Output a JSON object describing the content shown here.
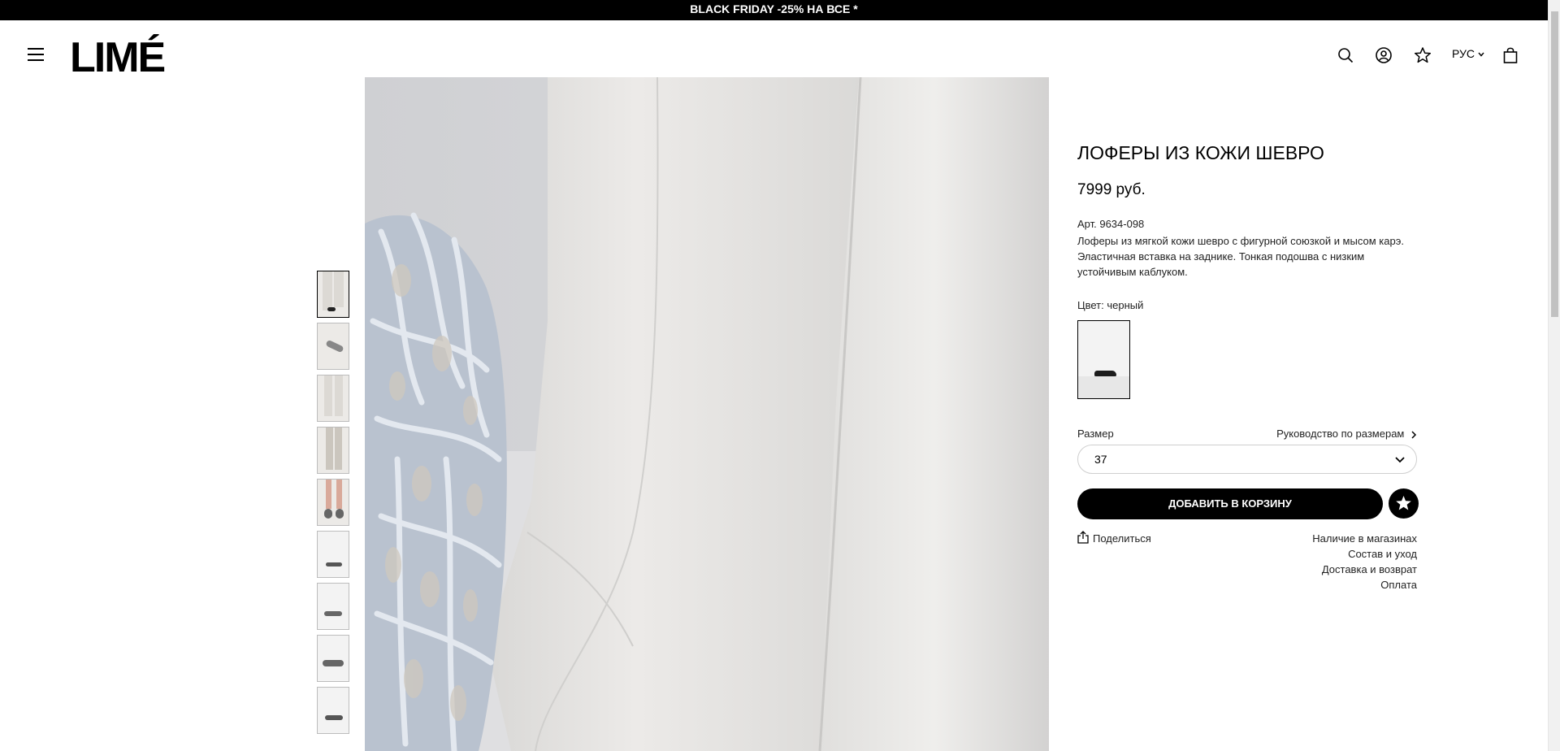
{
  "promo": {
    "text": "BLACK FRIDAY -25% НА ВСЕ *"
  },
  "header": {
    "logo": "LIMÉ",
    "language": "РУС",
    "icons": [
      "menu-icon",
      "search-icon",
      "account-icon",
      "favorites-star-icon",
      "chevron-down-icon",
      "cart-bag-icon"
    ]
  },
  "gallery": {
    "thumbnails": [
      "thumb-1",
      "thumb-2",
      "thumb-3",
      "thumb-4",
      "thumb-5",
      "thumb-6",
      "thumb-7",
      "thumb-8",
      "thumb-9"
    ],
    "active_index": 0
  },
  "product": {
    "title": "ЛОФЕРЫ ИЗ КОЖИ ШЕВРО",
    "price": "7999 руб.",
    "article": "Арт. 9634-098",
    "description": "Лоферы из мягкой кожи шевро с фигурной союзкой и мысом карэ. Эластичная вставка на заднике. Тонкая подошва с низким устойчивым каблуком.",
    "color_label": "Цвет: черный",
    "size_label": "Размер",
    "size_guide": "Руководство по размерам",
    "selected_size": "37",
    "add_to_cart": "ДОБАВИТЬ В КОРЗИНУ",
    "share": "Поделиться",
    "links": [
      "Наличие в магазинах",
      "Состав и уход",
      "Доставка и возврат",
      "Оплата"
    ]
  },
  "colors": {
    "accent": "#000000",
    "background": "#ffffff",
    "border": "#cfcfcf"
  }
}
